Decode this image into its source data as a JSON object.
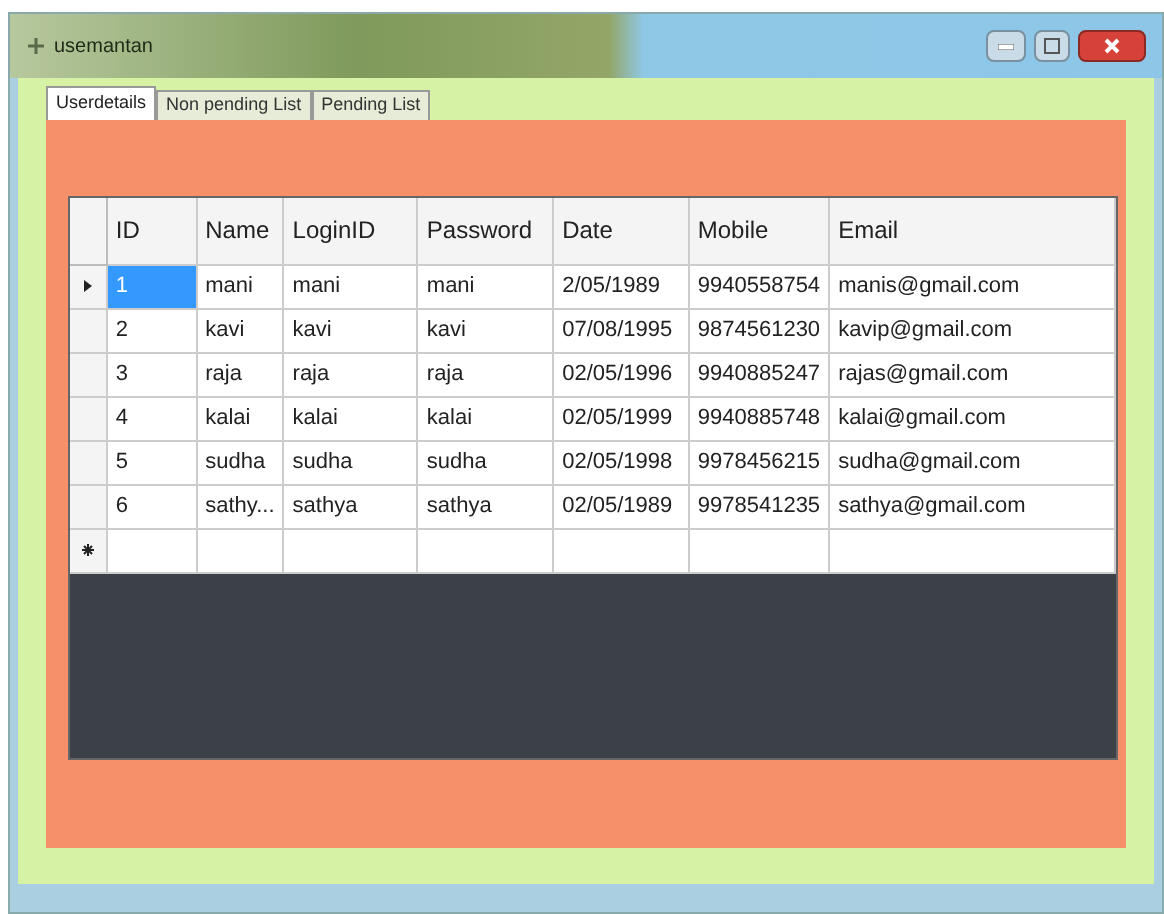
{
  "window": {
    "title": "usemantan"
  },
  "tabs": [
    {
      "label": "Userdetails",
      "selected": true
    },
    {
      "label": "Non pending List",
      "selected": false
    },
    {
      "label": "Pending List",
      "selected": false
    }
  ],
  "table": {
    "columns": [
      "ID",
      "Name",
      "LoginID",
      "Password",
      "Date",
      "Mobile",
      "Email"
    ],
    "rows": [
      {
        "selected": true,
        "cells": [
          "1",
          "mani",
          "mani",
          "mani",
          "2/05/1989",
          "9940558754",
          "manis@gmail.com"
        ]
      },
      {
        "selected": false,
        "cells": [
          "2",
          "kavi",
          "kavi",
          "kavi",
          "07/08/1995",
          "9874561230",
          "kavip@gmail.com"
        ]
      },
      {
        "selected": false,
        "cells": [
          "3",
          "raja",
          "raja",
          "raja",
          "02/05/1996",
          "9940885247",
          "rajas@gmail.com"
        ]
      },
      {
        "selected": false,
        "cells": [
          "4",
          "kalai",
          "kalai",
          "kalai",
          "02/05/1999",
          "9940885748",
          "kalai@gmail.com"
        ]
      },
      {
        "selected": false,
        "cells": [
          "5",
          "sudha",
          "sudha",
          "sudha",
          "02/05/1998",
          "9978456215",
          "sudha@gmail.com"
        ]
      },
      {
        "selected": false,
        "cells": [
          "6",
          "sathy...",
          "sathya",
          "sathya",
          "02/05/1989",
          "9978541235",
          "sathya@gmail.com"
        ]
      }
    ]
  }
}
